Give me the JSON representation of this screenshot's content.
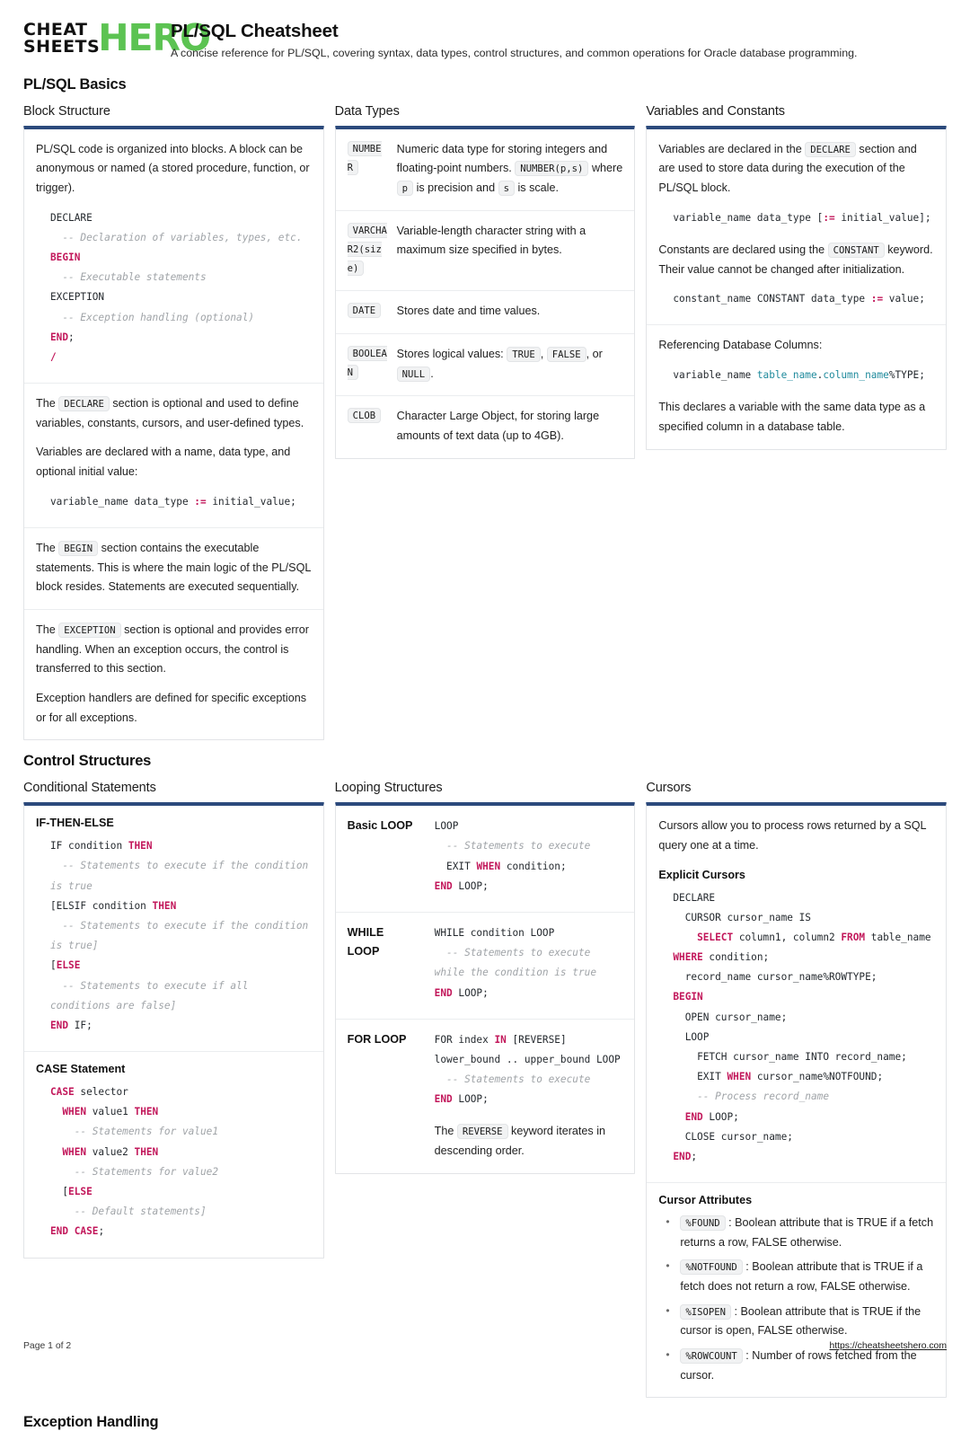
{
  "brand": {
    "line1": "CHEAT",
    "line2": "SHEETS",
    "hero": "HERO",
    "hero_color": "#5cc352"
  },
  "header": {
    "title": "PL/SQL Cheatsheet",
    "subtitle": "A concise reference for PL/SQL, covering syntax, data types, control structures, and common operations for Oracle database programming."
  },
  "theme": {
    "accent_border": "#2c4a7c",
    "keyword": "#c2185b",
    "comment": "#a0a4a8",
    "name": "#1f8a9c",
    "chip_bg": "#f1f2f3"
  },
  "sections": {
    "basics": "PL/SQL Basics",
    "control": "Control Structures",
    "exception": "Exception Handling"
  },
  "block_structure": {
    "title": "Block Structure",
    "intro": "PL/SQL code is organized into blocks. A block can be anonymous or named (a stored procedure, function, or trigger).",
    "code": "DECLARE\n  -- Declaration of variables, types, etc.\nBEGIN\n  -- Executable statements\nEXCEPTION\n  -- Exception handling (optional)\nEND;\n/",
    "declare_pre": "The",
    "declare_chip": "DECLARE",
    "declare_post": "section is optional and used to define variables, constants, cursors, and user-defined types.",
    "vars_text": "Variables are declared with a name, data type, and optional initial value:",
    "vars_code": "variable_name data_type := initial_value;",
    "begin_pre": "The",
    "begin_chip": "BEGIN",
    "begin_post": "section contains the executable statements. This is where the main logic of the PL/SQL block resides. Statements are executed sequentially.",
    "exc_pre": "The",
    "exc_chip": "EXCEPTION",
    "exc_post": "section is optional and provides error handling. When an exception occurs, the control is transferred to this section.",
    "exc_text2": "Exception handlers are defined for specific exceptions or for all exceptions."
  },
  "data_types": {
    "title": "Data Types",
    "rows": [
      {
        "type": "NUMBER",
        "desc_1": "Numeric data type for storing integers and floating-point numbers.",
        "chip_1": "NUMBER(p,s)",
        "desc_2": "where",
        "chip_2": "p",
        "desc_3": "is precision and",
        "chip_3": "s",
        "desc_4": "is scale."
      },
      {
        "type": "VARCHAR2(size)",
        "desc_1": "Variable-length character string with a maximum size specified in bytes."
      },
      {
        "type": "DATE",
        "desc_1": "Stores date and time values."
      },
      {
        "type": "BOOLEAN",
        "desc_1": "Stores logical values:",
        "chip_1": "TRUE",
        "desc_2": ",",
        "chip_2": "FALSE",
        "desc_3": ", or",
        "chip_3": "NULL",
        "desc_4": "."
      },
      {
        "type": "CLOB",
        "desc_1": "Character Large Object, for storing large amounts of text data (up to 4GB)."
      }
    ]
  },
  "variables": {
    "title": "Variables and Constants",
    "intro_pre": "Variables are declared in the",
    "intro_chip": "DECLARE",
    "intro_post": "section and are used to store data during the execution of the PL/SQL block.",
    "var_code": "variable_name data_type [:= initial_value];",
    "const_pre": "Constants are declared using the",
    "const_chip": "CONSTANT",
    "const_post": "keyword. Their value cannot be changed after initialization.",
    "const_code": "constant_name CONSTANT data_type := value;",
    "ref_label": "Referencing Database Columns:",
    "ref_code": "variable_name table_name.column_name%TYPE;",
    "ref_note": "This declares a variable with the same data type as a specified column in a database table."
  },
  "conditional": {
    "title": "Conditional Statements",
    "if_heading": "IF-THEN-ELSE",
    "if_code": "IF condition THEN\n  -- Statements to execute if the condition is true\n[ELSIF condition THEN\n  -- Statements to execute if the condition is true]\n[ELSE\n  -- Statements to execute if all conditions are false]\nEND IF;",
    "case_heading": "CASE Statement",
    "case_code": "CASE selector\n  WHEN value1 THEN\n    -- Statements for value1\n  WHEN value2 THEN\n    -- Statements for value2\n  [ELSE\n    -- Default statements]\nEND CASE;"
  },
  "looping": {
    "title": "Looping Structures",
    "rows": [
      {
        "label": "Basic LOOP",
        "code": "LOOP\n  -- Statements to execute\n  EXIT WHEN condition;\nEND LOOP;"
      },
      {
        "label": "WHILE LOOP",
        "code": "WHILE condition LOOP\n  -- Statements to execute while the condition is true\nEND LOOP;"
      },
      {
        "label": "FOR LOOP",
        "code": "FOR index IN [REVERSE] lower_bound .. upper_bound LOOP\n  -- Statements to execute\nEND LOOP;",
        "note_pre": "The",
        "note_chip": "REVERSE",
        "note_post": "keyword iterates in descending order."
      }
    ]
  },
  "cursors": {
    "title": "Cursors",
    "intro": "Cursors allow you to process rows returned by a SQL query one at a time.",
    "explicit_heading": "Explicit Cursors",
    "code": "DECLARE\n  CURSOR cursor_name IS\n    SELECT column1, column2 FROM table_name WHERE condition;\n  record_name cursor_name%ROWTYPE;\nBEGIN\n  OPEN cursor_name;\n  LOOP\n    FETCH cursor_name INTO record_name;\n    EXIT WHEN cursor_name%NOTFOUND;\n    -- Process record_name\n  END LOOP;\n  CLOSE cursor_name;\nEND;",
    "attrs_heading": "Cursor Attributes",
    "attributes": [
      {
        "chip": "%FOUND",
        "desc": ": Boolean attribute that is TRUE if a fetch returns a row, FALSE otherwise."
      },
      {
        "chip": "%NOTFOUND",
        "desc": ": Boolean attribute that is TRUE if a fetch does not return a row, FALSE otherwise."
      },
      {
        "chip": "%ISOPEN",
        "desc": ": Boolean attribute that is TRUE if the cursor is open, FALSE otherwise."
      },
      {
        "chip": "%ROWCOUNT",
        "desc": ": Number of rows fetched from the cursor."
      }
    ]
  },
  "footer": {
    "page": "Page 1 of 2",
    "url": "https://cheatsheetshero.com"
  }
}
